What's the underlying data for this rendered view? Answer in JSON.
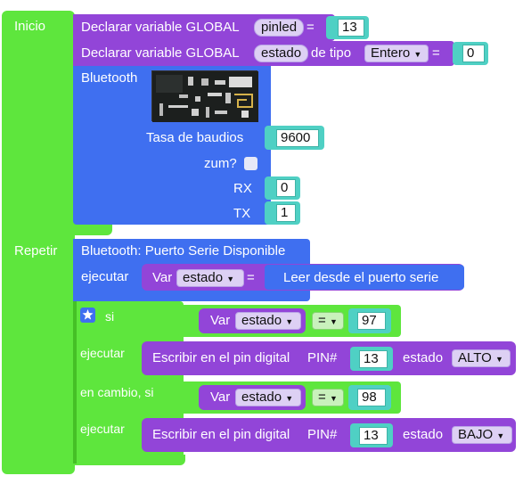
{
  "inicio": {
    "label": "Inicio",
    "declare_global_1": {
      "label": "Declarar variable GLOBAL",
      "var_name": "pinled",
      "equals": "=",
      "value": "13"
    },
    "declare_global_2": {
      "label": "Declarar variable GLOBAL",
      "var_name": "estado",
      "type_label": "de tipo",
      "type_value": "Entero",
      "equals": "=",
      "value": "0"
    },
    "bluetooth": {
      "label": "Bluetooth",
      "baud_label": "Tasa de baudios",
      "baud_value": "9600",
      "zoom_label": "zum?",
      "rx_label": "RX",
      "rx_value": "0",
      "tx_label": "TX",
      "tx_value": "1"
    }
  },
  "repetir": {
    "label": "Repetir",
    "serial_available": {
      "label": "Bluetooth: Puerto Serie Disponible",
      "execute_label": "ejecutar",
      "var_label": "Var",
      "var_name": "estado",
      "equals": "=",
      "read_label": "Leer desde el puerto serie"
    },
    "if_block": {
      "if_label": "si",
      "execute_label": "ejecutar",
      "else_if_label": "en cambio, si",
      "execute2_label": "ejecutar",
      "cond1": {
        "var_label": "Var",
        "var_name": "estado",
        "op": "=",
        "value": "97"
      },
      "cond2": {
        "var_label": "Var",
        "var_name": "estado",
        "op": "=",
        "value": "98"
      },
      "write1": {
        "label": "Escribir en el pin digital",
        "pin_label": "PIN#",
        "pin_value": "13",
        "state_label": "estado",
        "state_value": "ALTO"
      },
      "write2": {
        "label": "Escribir en el pin digital",
        "pin_label": "PIN#",
        "pin_value": "13",
        "state_label": "estado",
        "state_value": "BAJO"
      }
    }
  },
  "colors": {
    "green": "#5ee63d",
    "purple": "#9245d8",
    "blue": "#3f6ff0",
    "teal": "#4fd0c4"
  }
}
